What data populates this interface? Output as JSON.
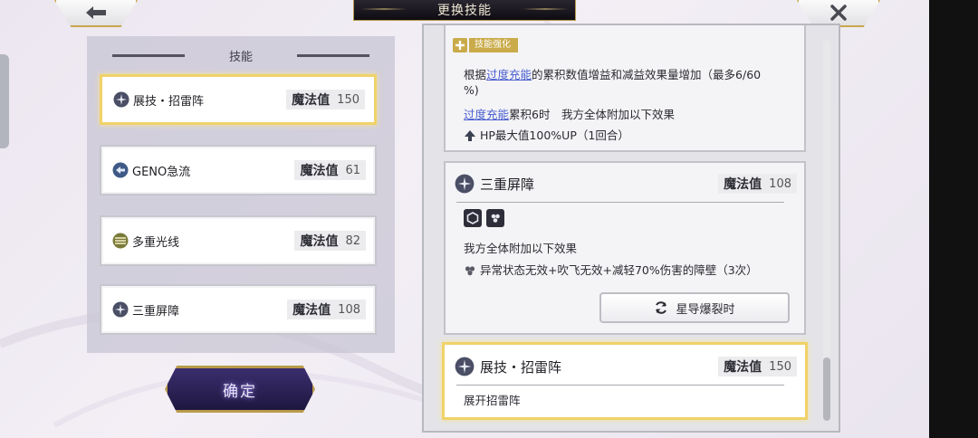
{
  "header": {
    "title": "更换技能"
  },
  "icons": {
    "back": "arrow-left-icon",
    "close": "close-x-icon"
  },
  "left_panel": {
    "heading": "技能",
    "items": [
      {
        "name": "展技・招雷阵",
        "mp_label": "魔法值",
        "mp": "150",
        "icon": "shield-burst-icon",
        "selected": true
      },
      {
        "name": "GENO急流",
        "mp_label": "魔法值",
        "mp": "61",
        "icon": "arrow-left-circle-icon",
        "selected": false
      },
      {
        "name": "多重光线",
        "mp_label": "魔法值",
        "mp": "82",
        "icon": "multi-beam-icon",
        "selected": false
      },
      {
        "name": "三重屏障",
        "mp_label": "魔法值",
        "mp": "108",
        "icon": "shield-burst-icon",
        "selected": false
      }
    ]
  },
  "confirm": {
    "label": "确定"
  },
  "details": {
    "top_card": {
      "tag": "技能强化",
      "line1_pre": "根据",
      "line1_link": "过度充能",
      "line1_post": "的累积数值增益和减益效果量增加（最多6/60",
      "line1_wrap": "%)",
      "line2_link": "过度充能",
      "line2_post": "累积6时　我方全体附加以下效果",
      "line3": "HP最大值100%UP（1回合）"
    },
    "mid_card": {
      "title": "三重屏障",
      "mp_label": "魔法值",
      "mp": "108",
      "effect_header": "我方全体附加以下效果",
      "effect": "异常状态无效+吹飞无效+减轻70%伤害的障壁（3次）",
      "trigger": "星导爆裂时"
    },
    "bottom_card": {
      "title": "展技・招雷阵",
      "mp_label": "魔法值",
      "mp": "150",
      "desc": "展开招雷阵"
    }
  },
  "colors": {
    "accent_gold": "#f0d26a",
    "link_blue": "#4a5ed0",
    "confirm_purple": "#2e2460"
  }
}
